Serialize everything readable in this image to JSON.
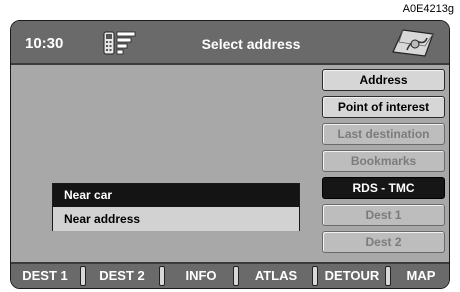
{
  "reference_code": "A0E4213g",
  "header": {
    "time": "10:30",
    "title": "Select address",
    "phone_icon": "phone-signal-icon",
    "map_icon": "map-icon"
  },
  "menu": [
    {
      "label": "Address",
      "state": "enabled"
    },
    {
      "label": "Point of interest",
      "state": "enabled"
    },
    {
      "label": "Last destination",
      "state": "disabled"
    },
    {
      "label": "Bookmarks",
      "state": "disabled"
    },
    {
      "label": "RDS - TMC",
      "state": "selected"
    },
    {
      "label": "Dest 1",
      "state": "disabled"
    },
    {
      "label": "Dest 2",
      "state": "disabled"
    }
  ],
  "popup": {
    "items": [
      {
        "label": "Near car",
        "state": "selected"
      },
      {
        "label": "Near address",
        "state": "normal"
      }
    ]
  },
  "softkeys": [
    "DEST 1",
    "DEST 2",
    "INFO",
    "ATLAS",
    "DETOUR",
    "MAP"
  ]
}
